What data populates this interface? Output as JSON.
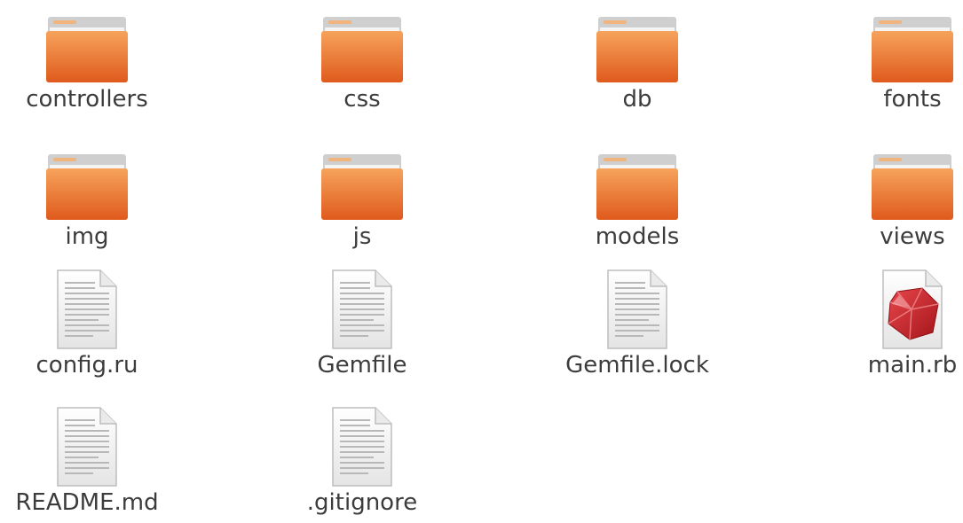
{
  "window": {
    "title": ""
  },
  "files": [
    {
      "name": "controllers",
      "type": "folder",
      "icon": "folder-icon"
    },
    {
      "name": "css",
      "type": "folder",
      "icon": "folder-icon"
    },
    {
      "name": "db",
      "type": "folder",
      "icon": "folder-icon"
    },
    {
      "name": "fonts",
      "type": "folder",
      "icon": "folder-icon"
    },
    {
      "name": "img",
      "type": "folder",
      "icon": "folder-icon"
    },
    {
      "name": "js",
      "type": "folder",
      "icon": "folder-icon"
    },
    {
      "name": "models",
      "type": "folder",
      "icon": "folder-icon"
    },
    {
      "name": "views",
      "type": "folder",
      "icon": "folder-icon"
    },
    {
      "name": "config.ru",
      "type": "text",
      "icon": "text-file-icon"
    },
    {
      "name": "Gemfile",
      "type": "text",
      "icon": "text-file-icon"
    },
    {
      "name": "Gemfile.lock",
      "type": "text",
      "icon": "text-file-icon"
    },
    {
      "name": "main.rb",
      "type": "ruby",
      "icon": "ruby-file-icon"
    },
    {
      "name": "README.md",
      "type": "text",
      "icon": "text-file-icon"
    },
    {
      "name": ".gitignore",
      "type": "text",
      "icon": "text-file-icon"
    }
  ],
  "colors": {
    "folder_light": "#f6a35c",
    "folder_dark": "#df5a1c",
    "folder_tab": "#e8e8e8",
    "ruby_red": "#c81f24",
    "label_text": "#3c3c3c"
  }
}
